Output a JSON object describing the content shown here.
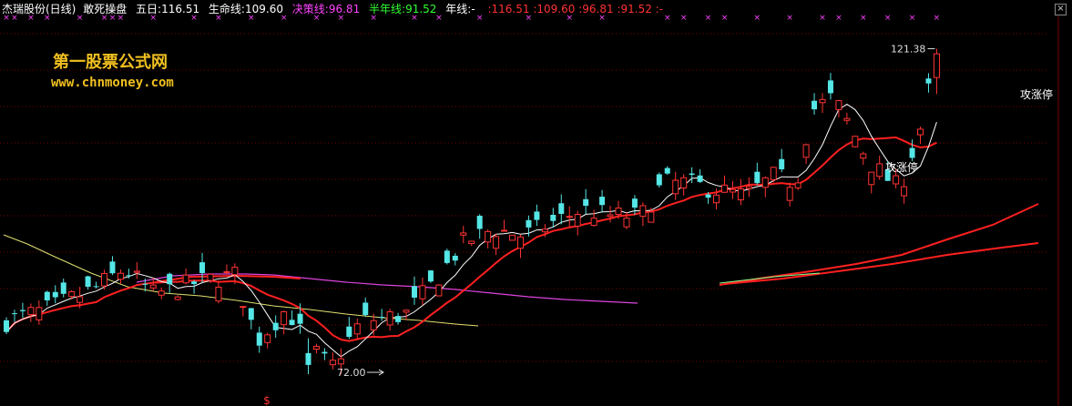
{
  "header": {
    "name": "杰瑞股份(日线)",
    "indicator": "敢死操盘",
    "items": [
      {
        "label": "五日:",
        "value": "116.51",
        "color": "#ffffff"
      },
      {
        "label": "生命线:",
        "value": "109.60",
        "color": "#ffffff"
      },
      {
        "label": "决策线:",
        "value": "96.81",
        "color": "#ff44ff"
      },
      {
        "label": "半年线:",
        "value": "91.52",
        "color": "#33ff33"
      },
      {
        "label": "年线:",
        "value": "-",
        "color": "#ffffff"
      }
    ],
    "trail": {
      "values": [
        ":116.51",
        ":109.60",
        ":96.81",
        ":91.52",
        ":-"
      ],
      "color": "#ff3333"
    }
  },
  "watermark": {
    "title": "第一股票公式网",
    "url": "www.chnmoney.com"
  },
  "chart_data": {
    "type": "candlestick",
    "ylim": [
      68,
      126
    ],
    "grid": "dashed-horizontal",
    "colors": {
      "up": "#ff3333",
      "down": "#55e6e6",
      "ma5": "#ffffff",
      "life_line": "#ff2020",
      "decision_line": "#ff44ff",
      "half_year_line": "#ff2020",
      "year_line": "#ff2020",
      "top_marker": "#ff44ff"
    },
    "annotations": [
      {
        "text": "121.38",
        "x": 113,
        "y": 121.4
      },
      {
        "text": "72.00",
        "x": 37,
        "y": 72.0
      },
      {
        "text": "$",
        "x": 27
      },
      {
        "text": "攻涨停",
        "x": 88,
        "y": 100.1
      },
      {
        "text": "攻涨停",
        "x": 113,
        "y": 109.4
      }
    ],
    "signal_marks": [
      0,
      1,
      3,
      5,
      9,
      12,
      13,
      14,
      18,
      23,
      26,
      30,
      34,
      38,
      41,
      45,
      50,
      53,
      57,
      63,
      68,
      72,
      80,
      82,
      85,
      87,
      91,
      95,
      99,
      101,
      104,
      107,
      110,
      113
    ],
    "last_values": {
      "ma5": 116.51,
      "life_line": 109.6,
      "decision_line": 96.81,
      "half_year_line": 91.52
    }
  }
}
